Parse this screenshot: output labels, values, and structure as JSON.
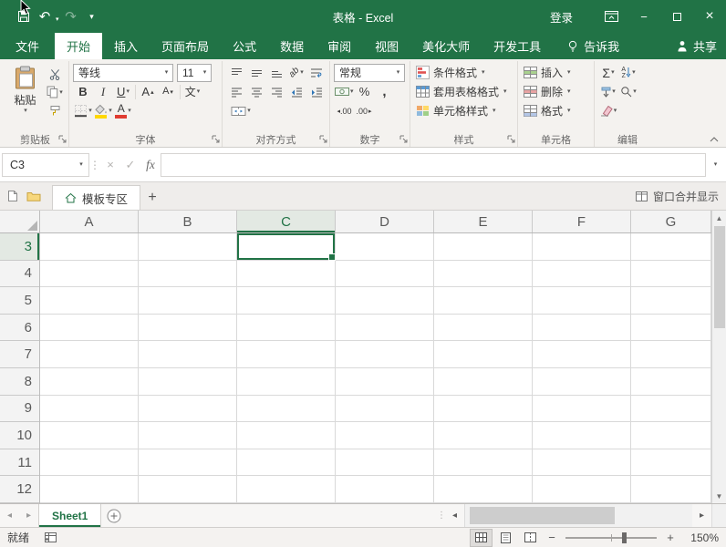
{
  "titlebar": {
    "title": "表格  -  Excel",
    "sign_in": "登录"
  },
  "ribbon_tabs": {
    "file": "文件",
    "tabs": [
      "开始",
      "插入",
      "页面布局",
      "公式",
      "数据",
      "审阅",
      "视图",
      "美化大师",
      "开发工具"
    ],
    "active": "开始",
    "tell_me": "告诉我",
    "share": "共享"
  },
  "ribbon": {
    "clipboard": {
      "label": "剪贴板",
      "paste": "粘贴"
    },
    "font": {
      "label": "字体",
      "font_name": "等线",
      "font_size": "11",
      "bold": "B",
      "italic": "I",
      "underline": "U",
      "grow_letter": "A",
      "shrink_letter": "A",
      "phonetic": "文",
      "color_letter": "A"
    },
    "alignment": {
      "label": "对齐方式",
      "orientation": "ab"
    },
    "number": {
      "label": "数字",
      "format": "常规",
      "percent": "%",
      "comma": ",",
      "decimal": ".00"
    },
    "styles": {
      "label": "样式",
      "conditional": "条件格式",
      "format_table": "套用表格格式",
      "cell_styles": "单元格样式"
    },
    "cells": {
      "label": "单元格",
      "insert": "插入",
      "delete": "删除",
      "format": "格式"
    },
    "editing": {
      "label": "编辑",
      "autosum": "Σ",
      "sort_a": "A",
      "sort_z": "Z"
    }
  },
  "formula_bar": {
    "name_box": "C3",
    "fx": "fx",
    "value": ""
  },
  "doc_bar": {
    "tab": "模板专区",
    "window_merge": "窗口合并显示"
  },
  "grid": {
    "columns": [
      "A",
      "B",
      "C",
      "D",
      "E",
      "F",
      "G"
    ],
    "rows": [
      "3",
      "4",
      "5",
      "6",
      "7",
      "8",
      "9",
      "10",
      "11",
      "12"
    ],
    "active_cell": "C3"
  },
  "sheet_bar": {
    "sheet": "Sheet1"
  },
  "status_bar": {
    "ready": "就绪",
    "zoom": "150%"
  },
  "colors": {
    "accent_green": "#217346",
    "font_color_red": "#e03c31",
    "fill_color_yellow": "#ffd800"
  }
}
